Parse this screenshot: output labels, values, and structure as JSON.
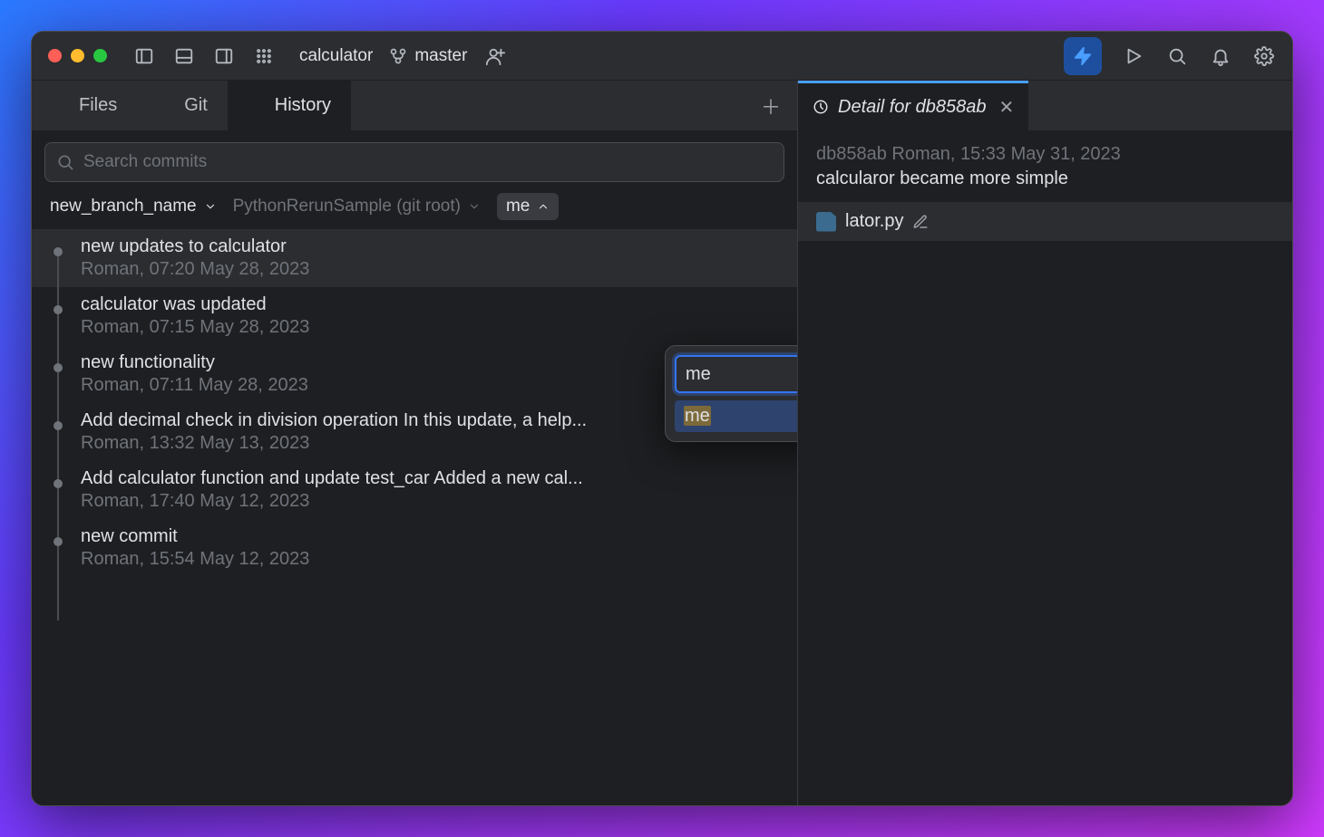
{
  "titlebar": {
    "project_name": "calculator",
    "branch": "master"
  },
  "left_tabs": [
    "Files",
    "Git",
    "History"
  ],
  "search": {
    "placeholder": "Search commits"
  },
  "filters": {
    "branch": "new_branch_name",
    "repo": "PythonRerunSample (git root)",
    "user": "me"
  },
  "commits": [
    {
      "title": "new updates to calculator",
      "meta": "Roman, 07:20 May 28, 2023"
    },
    {
      "title": "calculator was updated",
      "meta": "Roman, 07:15 May 28, 2023"
    },
    {
      "title": "new functionality",
      "meta": "Roman, 07:11 May 28, 2023"
    },
    {
      "title": "Add decimal check in division operation  In this update, a help...",
      "meta": "Roman, 13:32 May 13, 2023"
    },
    {
      "title": "Add calculator function and update test_car  Added a new cal...",
      "meta": "Roman, 17:40 May 12, 2023"
    },
    {
      "title": "new commit",
      "meta": "Roman, 15:54 May 12, 2023"
    }
  ],
  "detail": {
    "tab_label": "Detail for db858ab",
    "meta": "db858ab Roman, 15:33 May 31, 2023",
    "message": "calcularor became more simple",
    "file": "lator.py"
  },
  "popup": {
    "input_value": "me",
    "option": "me"
  }
}
